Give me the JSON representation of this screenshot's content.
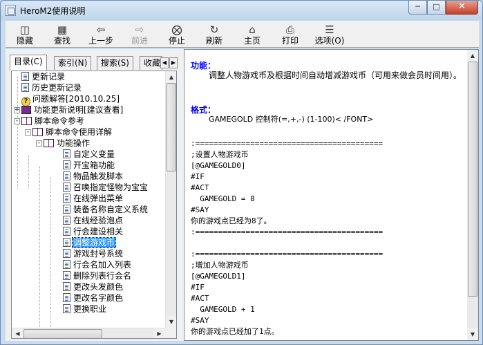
{
  "window": {
    "title": "HeroM2使用说明"
  },
  "toolbar": {
    "buttons": [
      {
        "label": "隐藏",
        "icon": "hide-icon"
      },
      {
        "label": "查找",
        "icon": "find-icon"
      },
      {
        "label": "上一步",
        "icon": "back-arrow-icon"
      },
      {
        "label": "前进",
        "icon": "forward-arrow-icon",
        "disabled": true
      },
      {
        "label": "停止",
        "icon": "stop-icon"
      },
      {
        "label": "刷新",
        "icon": "refresh-icon"
      },
      {
        "label": "主页",
        "icon": "home-icon"
      },
      {
        "label": "打印",
        "icon": "print-icon"
      },
      {
        "label": "选项(O)",
        "icon": "options-icon"
      }
    ]
  },
  "tabs": [
    {
      "label": "目录(C)",
      "active": true
    },
    {
      "label": "索引(N)"
    },
    {
      "label": "搜索(S)"
    },
    {
      "label": "收藏"
    }
  ],
  "tree": {
    "items": [
      {
        "label": "更新记录",
        "icon": "document-icon"
      },
      {
        "label": "历史更新记录",
        "icon": "document-icon"
      },
      {
        "label": "问题解答[2010.10.25]",
        "icon": "help-question-icon"
      },
      {
        "label": "功能更新说明[建议查看]",
        "icon": "closed-book-icon"
      },
      {
        "label": "脚本命令参考",
        "icon": "open-book-icon"
      },
      {
        "label": "脚本命令使用详解",
        "icon": "open-book-icon"
      },
      {
        "label": "功能操作",
        "icon": "open-book-icon"
      },
      {
        "label": "自定义变量",
        "icon": "document-icon"
      },
      {
        "label": "开宝箱功能",
        "icon": "document-icon"
      },
      {
        "label": "物品触发脚本",
        "icon": "document-icon"
      },
      {
        "label": "召唤指定怪物为宝宝",
        "icon": "document-icon"
      },
      {
        "label": "在线弹出菜单",
        "icon": "document-icon"
      },
      {
        "label": "装备名称自定义系统",
        "icon": "document-icon"
      },
      {
        "label": "在线经验泡点",
        "icon": "document-icon"
      },
      {
        "label": "行会建设相关",
        "icon": "document-icon"
      },
      {
        "label": "调整游戏币",
        "icon": "document-icon",
        "selected": true
      },
      {
        "label": "游戏封号系统",
        "icon": "document-icon"
      },
      {
        "label": "行会名加入列表",
        "icon": "document-icon"
      },
      {
        "label": "删除列表行会名",
        "icon": "document-icon"
      },
      {
        "label": "更改头发颜色",
        "icon": "document-icon"
      },
      {
        "label": "更改名字颜色",
        "icon": "document-icon"
      },
      {
        "label": "更换职业",
        "icon": "document-icon"
      }
    ]
  },
  "content": {
    "function_heading": "功能：",
    "function_text": "调整人物游戏币及根据时间自动增减游戏币（可用来做会员时间用）。",
    "format_heading": "格式：",
    "format_text": "GAMEGOLD 控制符(=,+,-)   (1-100)< /FONT>",
    "separator": ":=========================================",
    "block1_comment": ";设置人物游戏币",
    "block1_label": "[@GAMEGOLD0]",
    "block1_if": "#IF",
    "block1_act": "#ACT",
    "block1_cmd": "  GAMEGOLD = 8",
    "block1_say": "#SAY",
    "block1_msg": "你的游戏点已经为8了。",
    "block2_comment": ";增加人物游戏币",
    "block2_label": "[@GAMEGOLD1]",
    "block2_if": "#IF",
    "block2_act": "#ACT",
    "block2_cmd": "  GAMEGOLD + 1",
    "block2_say": "#SAY",
    "block2_msg": "你的游戏点已经加了1点。"
  }
}
